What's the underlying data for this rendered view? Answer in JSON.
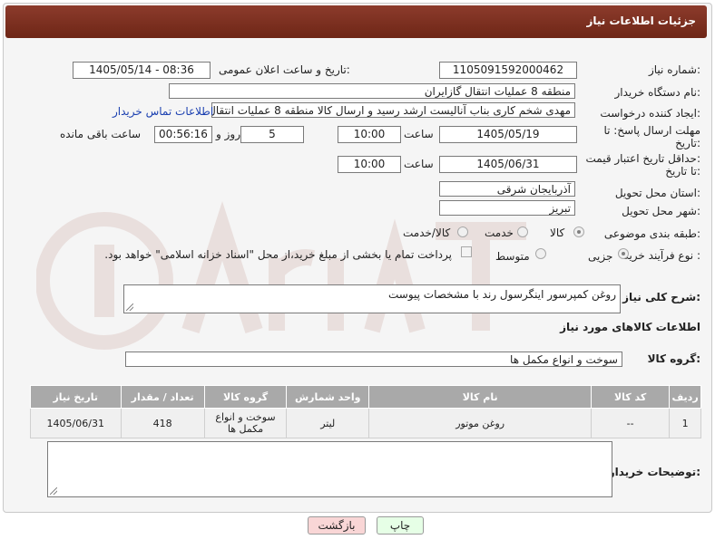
{
  "header": {
    "title": "جزئیات اطلاعات نیاز"
  },
  "fields": {
    "need_number_label": "شماره نیاز:",
    "need_number": "1105091592000462",
    "announce_label": "تاریخ و ساعت اعلان عمومی:",
    "announce_value": "1405/05/14 - 08:36",
    "buyer_org_label": "نام دستگاه خریدار:",
    "buyer_org": "منطقه 8 عملیات انتقال گازایران",
    "creator_label": "ایجاد کننده درخواست:",
    "creator": "مهدی شخم کاری بناب آنالیست ارشد رسید و ارسال کالا منطقه 8 عملیات انتقال",
    "contact_link": "اطلاعات تماس خریدار",
    "deadline_label_1": "مهلت ارسال پاسخ: تا",
    "deadline_label_2": "تاریخ:",
    "deadline_date": "1405/05/19",
    "time_label": "ساعت",
    "deadline_time": "10:00",
    "days_value": "5",
    "days_label": "روز و",
    "remaining_time": "00:56:16",
    "remaining_label": "ساعت باقی مانده",
    "price_label_1": "حداقل تاریخ اعتبار قیمت:",
    "price_label_2": "تا تاریخ:",
    "price_date": "1405/06/31",
    "price_time": "10:00",
    "province_label": "استان محل تحویل:",
    "province": "آذربایجان شرقی",
    "city_label": "شهر محل تحویل:",
    "city": "تبریز",
    "category_label": "طبقه بندی موضوعی:",
    "category_options": [
      "کالا",
      "خدمت",
      "کالا/خدمت"
    ],
    "process_label": "نوع فرآیند خرید :",
    "process_options": [
      "جزیی",
      "متوسط"
    ],
    "payment_note": "پرداخت تمام یا بخشی از مبلغ خرید،از محل \"اسناد خزانه اسلامی\" خواهد بود.",
    "description_label": "شرح کلی نیاز:",
    "description": "روغن کمپرسور اینگرسول رند با مشخصات پیوست",
    "goods_info_title": "اطلاعات کالاهای مورد نیاز",
    "goods_group_label": "گروه کالا:",
    "goods_group": "سوخت و انواع مکمل ها",
    "buyer_notes_label": "توضیحات خریدار:"
  },
  "table": {
    "headers": [
      "ردیف",
      "کد کالا",
      "نام کالا",
      "واحد شمارش",
      "گروه کالا",
      "تعداد / مقدار",
      "تاریخ نیاز"
    ],
    "rows": [
      [
        "1",
        "--",
        "روغن موتور",
        "لیتر",
        "سوخت و انواع مکمل ها",
        "418",
        "1405/06/31"
      ]
    ]
  },
  "buttons": {
    "print": "چاپ",
    "back": "بازگشت"
  },
  "colors": {
    "header_bg": "#7a2c1c",
    "link": "#1a3fb0",
    "back_btn_bg": "#f9d6d6",
    "print_btn_bg": "#e6ffe6"
  }
}
